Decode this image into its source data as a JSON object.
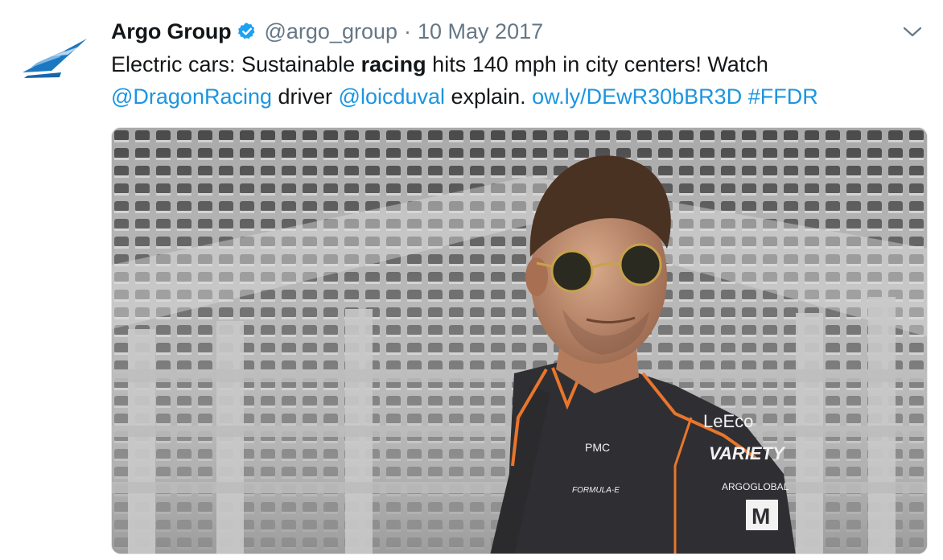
{
  "author": {
    "name": "Argo Group",
    "handle": "@argo_group",
    "separator": "·",
    "date": "10 May 2017"
  },
  "tweet": {
    "line1": {
      "before": "Electric cars: Sustainable ",
      "bold": "racing",
      "after": " hits 140 mph in city centers! Watch"
    },
    "line2": {
      "mention1": "@DragonRacing",
      "text1": " driver ",
      "mention2": "@loicduval",
      "text2": " explain. ",
      "url": "ow.ly/DEwR30bBR3D",
      "space": " ",
      "hashtag": "#FFDR"
    }
  },
  "media": {
    "shirt_logos": [
      "LeEco",
      "VARIETY",
      "ARGOGLOBAL",
      "M",
      "PMC",
      "FORMULA-E"
    ]
  },
  "colors": {
    "link": "#1b95e0",
    "secondary": "#657786",
    "verified": "#1da1f2",
    "brand_blue": "#1a78c2",
    "accent_orange": "#e8762c"
  },
  "icons": {
    "avatar": "argo-logo-icon",
    "verified": "verified-badge-icon",
    "caret": "chevron-down-icon"
  }
}
